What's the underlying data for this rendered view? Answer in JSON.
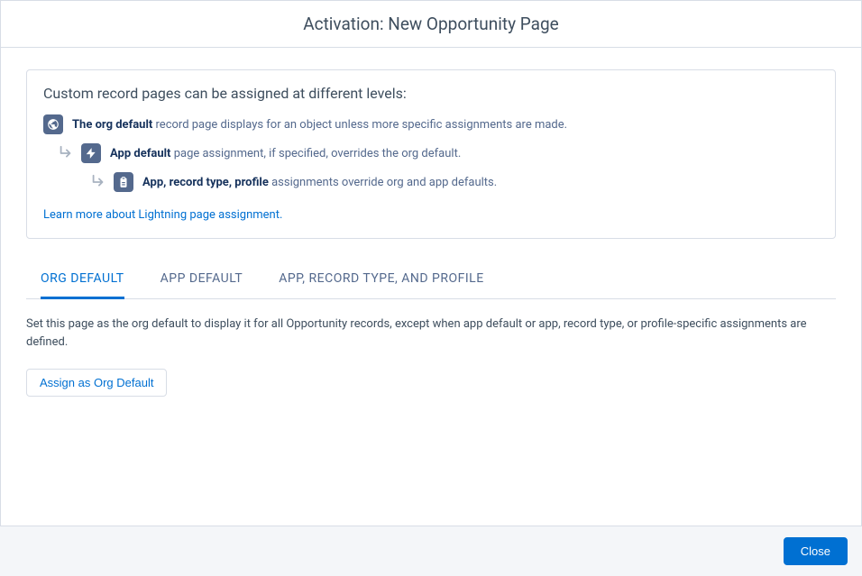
{
  "header": {
    "title": "Activation: New Opportunity Page"
  },
  "info": {
    "heading": "Custom record pages can be assigned at different levels:",
    "levels": [
      {
        "bold": "The org default",
        "rest": " record page displays for an object unless more specific assignments are made."
      },
      {
        "bold": "App default",
        "rest": " page assignment, if specified, overrides the org default."
      },
      {
        "bold": "App, record type, profile",
        "rest": " assignments override org and app defaults."
      }
    ],
    "learn_more": "Learn more about Lightning page assignment."
  },
  "tabs": [
    {
      "label": "ORG DEFAULT",
      "active": true
    },
    {
      "label": "APP DEFAULT",
      "active": false
    },
    {
      "label": "APP, RECORD TYPE, AND PROFILE",
      "active": false
    }
  ],
  "tab_content": {
    "description": "Set this page as the org default to display it for all Opportunity records, except when app default or app, record type, or profile-specific assignments are defined.",
    "assign_button": "Assign as Org Default"
  },
  "footer": {
    "close": "Close"
  }
}
